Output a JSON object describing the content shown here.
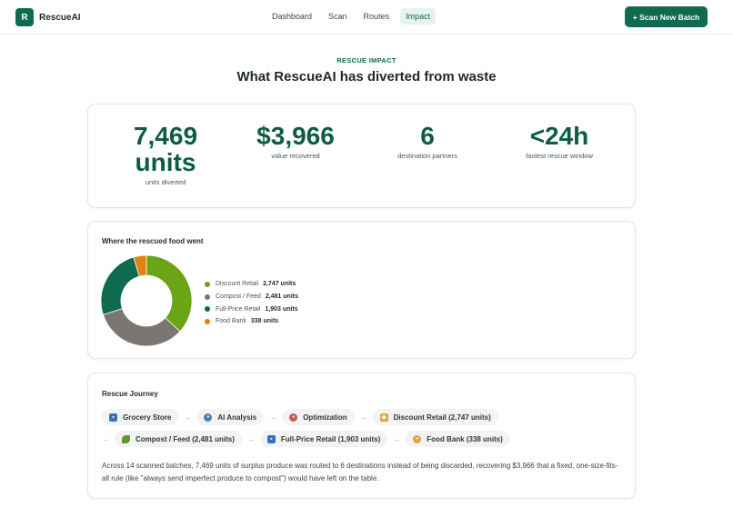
{
  "app": {
    "name": "RescueAI",
    "logo_letter": "R"
  },
  "nav": [
    {
      "label": "Dashboard",
      "active": false
    },
    {
      "label": "Scan",
      "active": false
    },
    {
      "label": "Routes",
      "active": false
    },
    {
      "label": "Impact",
      "active": true
    }
  ],
  "header": {
    "cta_label": "+ Scan New Batch"
  },
  "hero": {
    "eyebrow": "RESCUE IMPACT",
    "title": "What RescueAI has diverted from waste"
  },
  "stats": [
    {
      "value_line1": "7,469",
      "value_line2": "units",
      "label": "units diverted"
    },
    {
      "value_line1": "$3,966",
      "value_line2": "",
      "label": "value recovered"
    },
    {
      "value_line1": "6",
      "value_line2": "",
      "label": "destination partners"
    },
    {
      "value_line1": "<24h",
      "value_line2": "",
      "label": "fastest rescue window"
    }
  ],
  "distribution": {
    "title": "Where the rescued food went",
    "chart_data": {
      "type": "pie",
      "categories": [
        "Discount Retail",
        "Compost / Feed",
        "Full-Price Retail",
        "Food Bank"
      ],
      "values": [
        2747,
        2481,
        1903,
        338
      ],
      "value_labels": [
        "2,747 units",
        "2,481 units",
        "1,903 units",
        "338 units"
      ],
      "colors": [
        "#6aa515",
        "#7b7672",
        "#0e6b4f",
        "#e0820f"
      ],
      "donut": true,
      "legend": "right"
    }
  },
  "journey": {
    "title": "Rescue Journey",
    "row1": [
      {
        "label": "Grocery Store",
        "icon": "store-icon",
        "color": "#3c6fbf"
      },
      {
        "label": "AI Analysis",
        "icon": "magnifier-icon",
        "color": "#4b7fc4"
      },
      {
        "label": "Optimization",
        "icon": "target-icon",
        "color": "#c85a4e"
      },
      {
        "label": "Discount Retail (2,747 units)",
        "icon": "tag-icon",
        "color": "#e0a43a"
      }
    ],
    "row2": [
      {
        "label": "Compost / Feed (2,481 units)",
        "icon": "seedling-icon",
        "color": "#5e9a2b"
      },
      {
        "label": "Full-Price Retail (1,903 units)",
        "icon": "store-icon",
        "color": "#3c6fbf"
      },
      {
        "label": "Food Bank (338 units)",
        "icon": "handshake-icon",
        "color": "#e0a43a"
      }
    ],
    "arrow": "→",
    "summary": "Across 14 scanned batches, 7,469 units of surplus produce was routed to 6 destinations instead of being discarded, recovering $3,966 that a fixed, one-size-fits-all rule (like \"always send imperfect produce to compost\") would have left on the table."
  }
}
